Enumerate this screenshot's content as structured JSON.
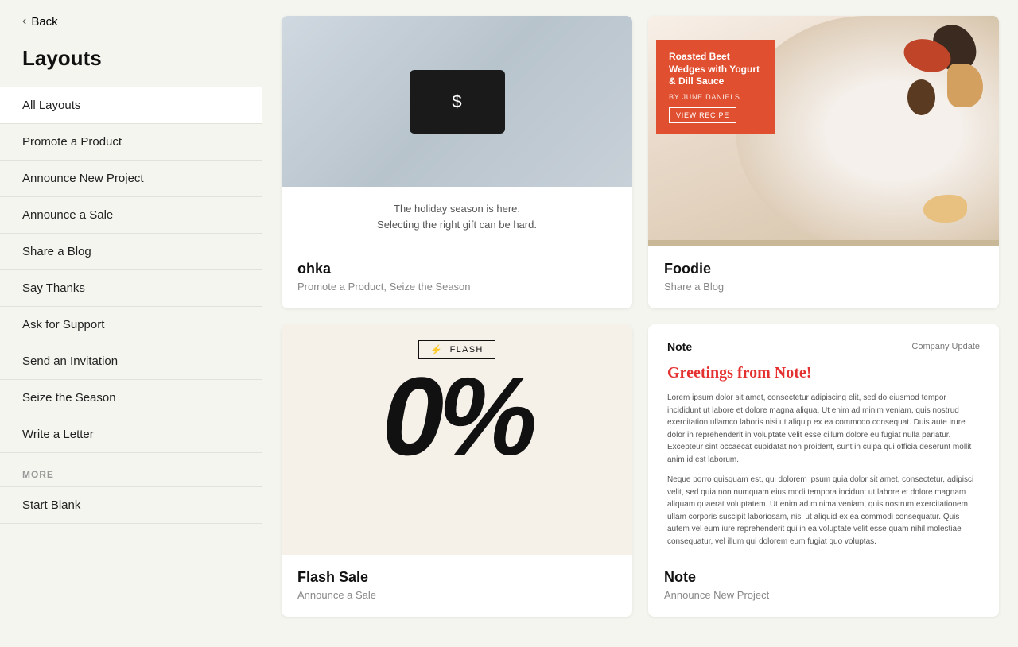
{
  "sidebar": {
    "back_label": "Back",
    "title": "Layouts",
    "nav_items": [
      {
        "id": "all-layouts",
        "label": "All Layouts",
        "active": true
      },
      {
        "id": "promote-product",
        "label": "Promote a Product",
        "active": false
      },
      {
        "id": "announce-new-project",
        "label": "Announce New Project",
        "active": false
      },
      {
        "id": "announce-sale",
        "label": "Announce a Sale",
        "active": false
      },
      {
        "id": "share-blog",
        "label": "Share a Blog",
        "active": false
      },
      {
        "id": "say-thanks",
        "label": "Say Thanks",
        "active": false
      },
      {
        "id": "ask-support",
        "label": "Ask for Support",
        "active": false
      },
      {
        "id": "send-invitation",
        "label": "Send an Invitation",
        "active": false
      },
      {
        "id": "seize-season",
        "label": "Seize the Season",
        "active": false
      },
      {
        "id": "write-letter",
        "label": "Write a Letter",
        "active": false
      }
    ],
    "more_label": "MORE",
    "more_items": [
      {
        "id": "start-blank",
        "label": "Start Blank"
      }
    ]
  },
  "cards": [
    {
      "id": "ohka",
      "name": "ohka",
      "tags": "Promote a Product, Seize the Season",
      "preview": {
        "caption_line1": "The holiday season is here.",
        "caption_line2": "Selecting the right gift can be hard.",
        "wallet_symbol": "$"
      }
    },
    {
      "id": "foodie",
      "name": "Foodie",
      "tags": "Share a Blog",
      "preview": {
        "recipe_title": "Roasted Beet Wedges with Yogurt & Dill Sauce",
        "recipe_author": "BY JUNE DANIELS",
        "recipe_btn": "VIEW RECIPE"
      }
    },
    {
      "id": "flash",
      "name": "Flash Sale",
      "tags": "Announce a Sale",
      "preview": {
        "flash_label": "FLASH",
        "flash_icon": "⚡",
        "percent": "0%"
      }
    },
    {
      "id": "note",
      "name": "Note",
      "tags": "Announce New Project",
      "preview": {
        "brand": "Note",
        "tag": "Company Update",
        "greeting": "Greetings from Note!",
        "body1": "Lorem ipsum dolor sit amet, consectetur adipiscing elit, sed do eiusmod tempor incididunt ut labore et dolore magna aliqua. Ut enim ad minim veniam, quis nostrud exercitation ullamco laboris nisi ut aliquip ex ea commodo consequat. Duis aute irure dolor in reprehenderit in voluptate velit esse cillum dolore eu fugiat nulla pariatur. Excepteur sint occaecat cupidatat non proident, sunt in culpa qui officia deserunt mollit anim id est laborum.",
        "body2": "Neque porro quisquam est, qui dolorem ipsum quia dolor sit amet, consectetur, adipisci velit, sed quia non numquam eius modi tempora incidunt ut labore et dolore magnam aliquam quaerat voluptatem. Ut enim ad minima veniam, quis nostrum exercitationem ullam corporis suscipit laboriosam, nisi ut aliquid ex ea commodi consequatur. Quis autem vel eum iure reprehenderit qui in ea voluptate velit esse quam nihil molestiae consequatur, vel illum qui dolorem eum fugiat quo voluptas."
      }
    }
  ]
}
